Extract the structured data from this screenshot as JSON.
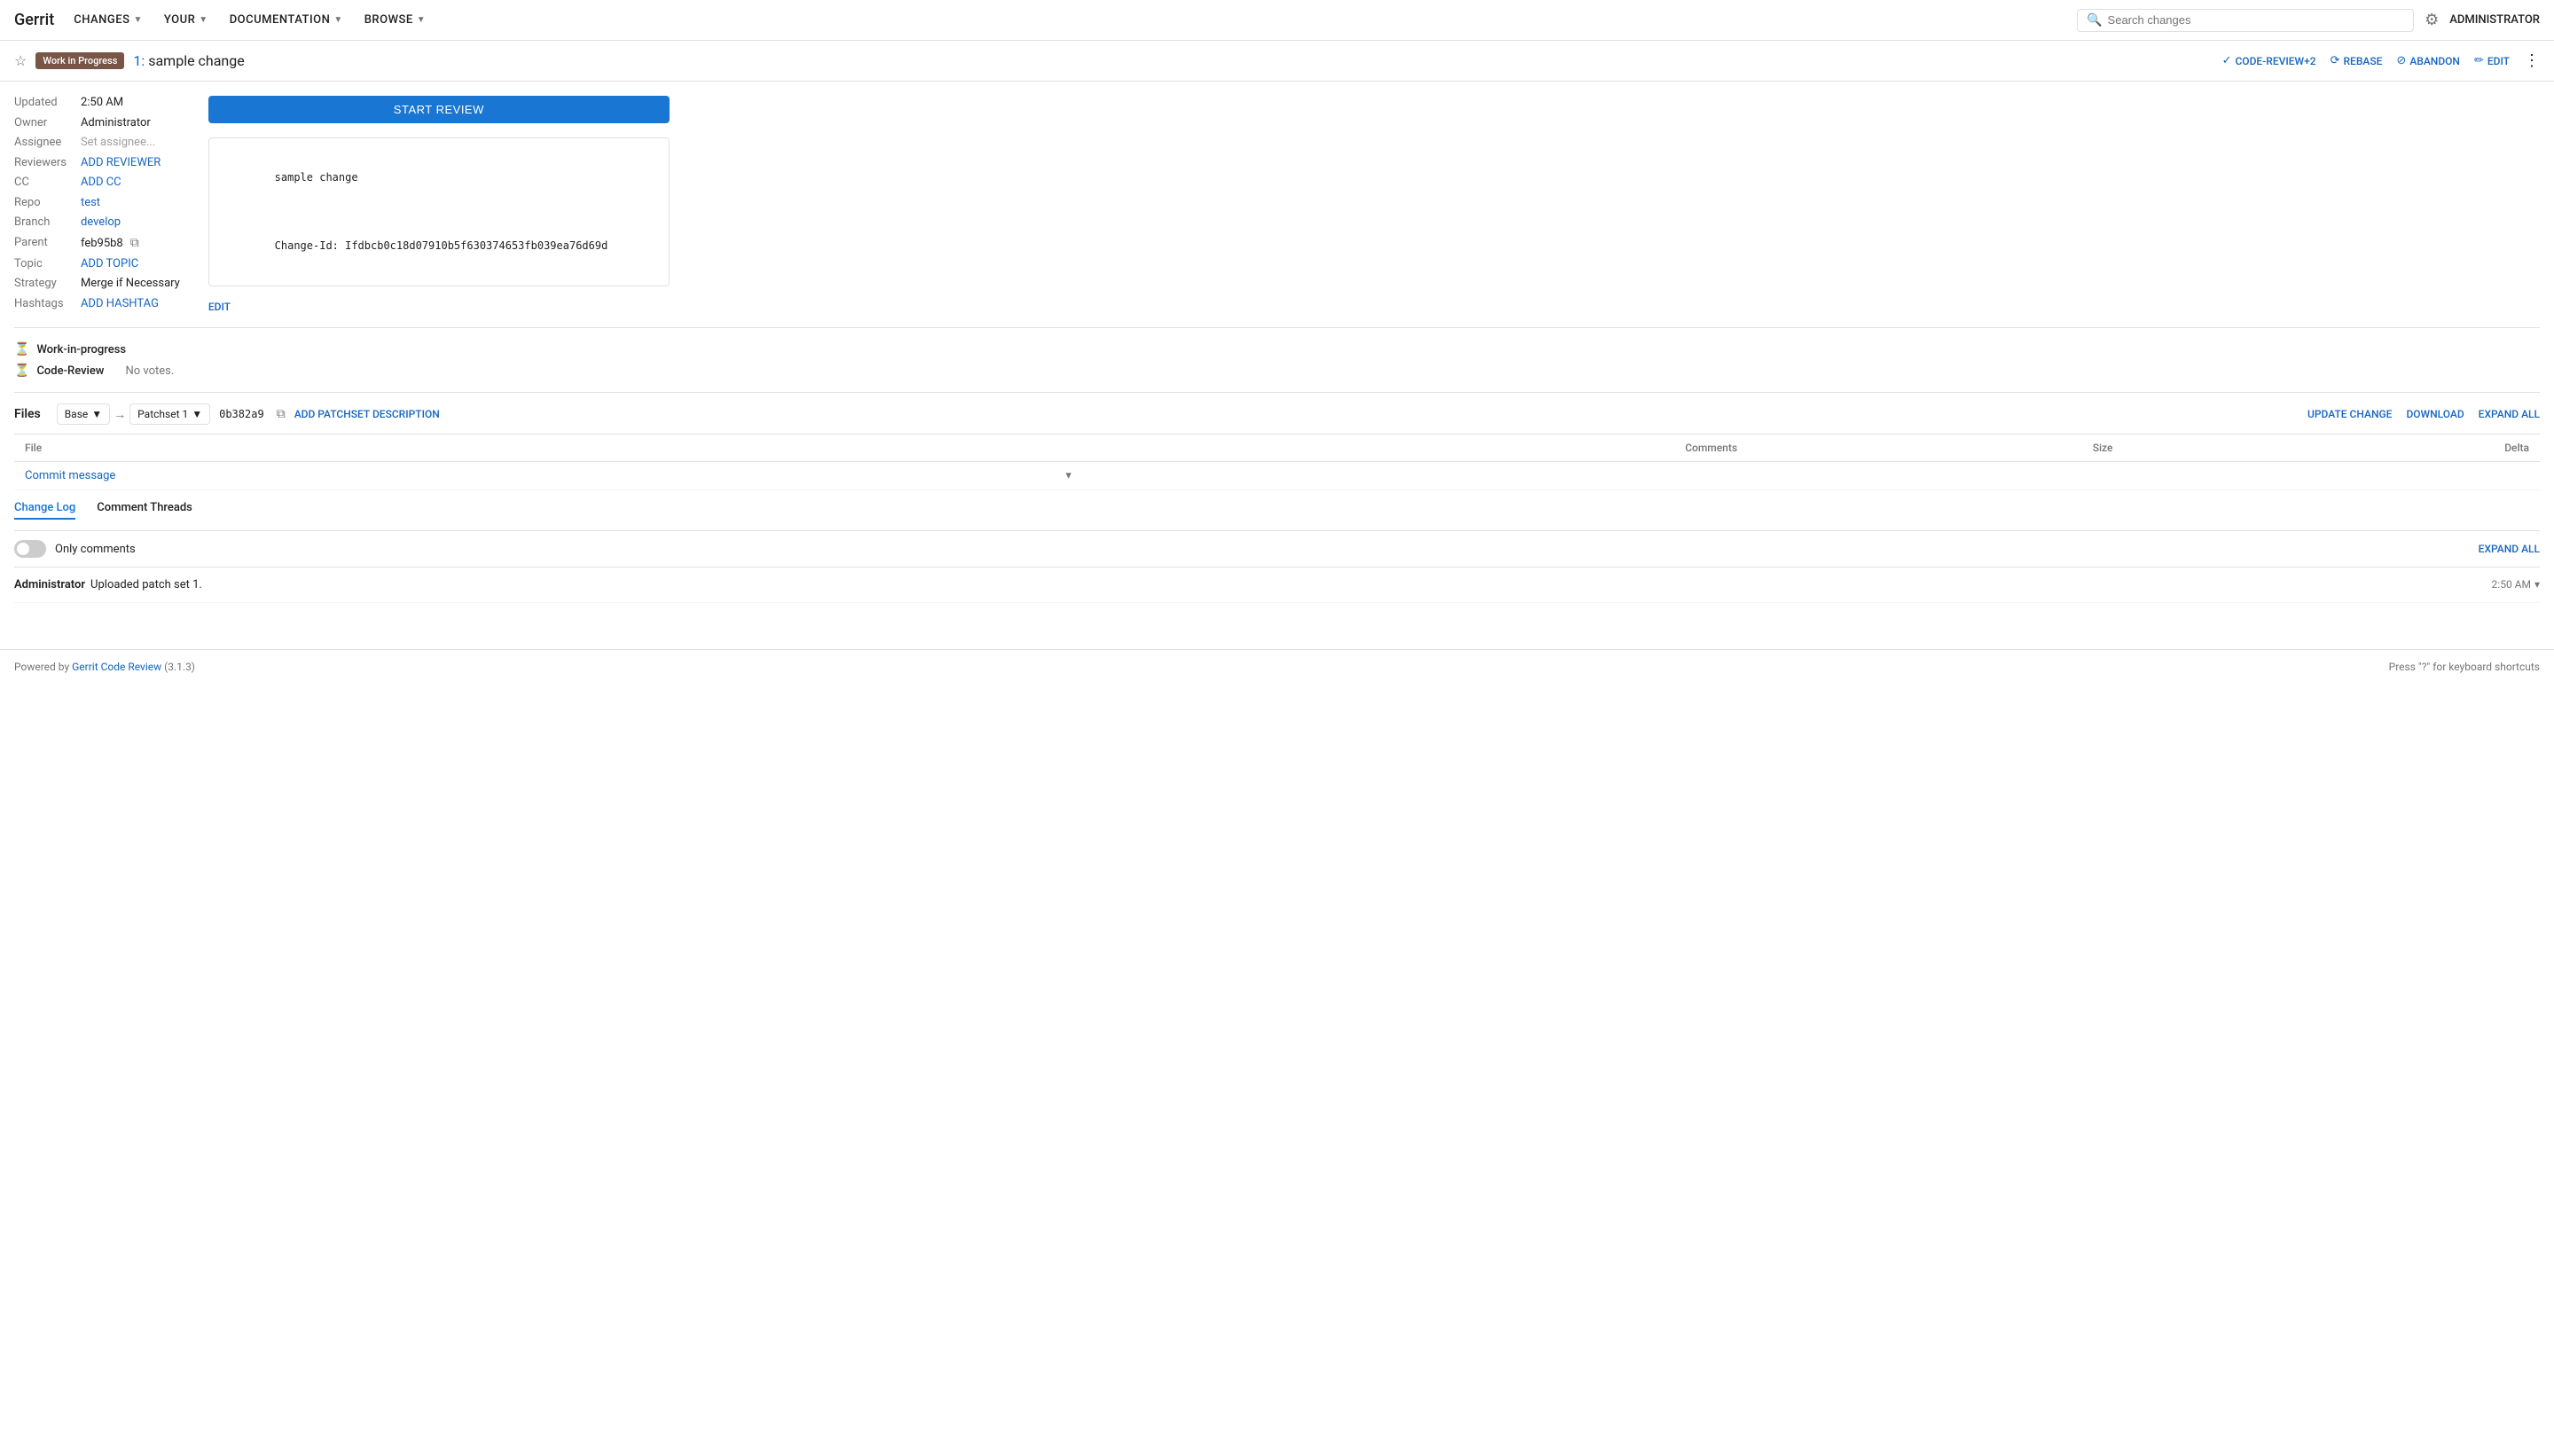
{
  "app": {
    "logo": "Gerrit"
  },
  "navbar": {
    "items": [
      {
        "label": "CHANGES",
        "id": "changes"
      },
      {
        "label": "YOUR",
        "id": "your"
      },
      {
        "label": "DOCUMENTATION",
        "id": "documentation"
      },
      {
        "label": "BROWSE",
        "id": "browse"
      }
    ],
    "search_placeholder": "Search changes",
    "admin_label": "ADMINISTRATOR"
  },
  "change_header": {
    "star_icon": "☆",
    "wip_label": "Work in Progress",
    "change_number": "1",
    "change_title": "sample change",
    "actions": {
      "code_review": "CODE-REVIEW+2",
      "rebase": "REBASE",
      "abandon": "ABANDON",
      "edit": "EDIT",
      "more": "⋮"
    }
  },
  "metadata": {
    "updated_label": "Updated",
    "updated_value": "2:50 AM",
    "owner_label": "Owner",
    "owner_value": "Administrator",
    "assignee_label": "Assignee",
    "assignee_placeholder": "Set assignee...",
    "reviewers_label": "Reviewers",
    "add_reviewer": "ADD REVIEWER",
    "cc_label": "CC",
    "add_cc": "ADD CC",
    "repo_label": "Repo",
    "repo_value": "test",
    "branch_label": "Branch",
    "branch_value": "develop",
    "parent_label": "Parent",
    "parent_value": "feb95b8",
    "topic_label": "Topic",
    "add_topic": "ADD TOPIC",
    "strategy_label": "Strategy",
    "strategy_value": "Merge if Necessary",
    "hashtags_label": "Hashtags",
    "add_hashtag": "ADD HASHTAG"
  },
  "commit_msg": {
    "start_review_label": "START REVIEW",
    "message_line1": "sample change",
    "message_line2": "",
    "message_line3": "Change-Id: Ifdbcb0c18d07910b5f630374653fb039ea76d69d",
    "edit_label": "EDIT"
  },
  "labels": [
    {
      "name": "Work-in-progress",
      "icon": "⏳"
    },
    {
      "name": "Code-Review",
      "icon": "⏳",
      "votes": "No votes."
    }
  ],
  "files": {
    "title": "Files",
    "base_label": "Base",
    "patchset_label": "Patchset 1",
    "commit_hash": "0b382a9",
    "add_patchset_desc": "ADD PATCHSET DESCRIPTION",
    "update_change": "UPDATE CHANGE",
    "download": "DOWNLOAD",
    "expand_all": "EXPAND ALL",
    "columns": {
      "file": "File",
      "comments": "Comments",
      "size": "Size",
      "delta": "Delta"
    },
    "rows": [
      {
        "name": "Commit message",
        "comments": "",
        "size": "",
        "delta": ""
      }
    ]
  },
  "changelog": {
    "tabs": [
      {
        "label": "Change Log",
        "active": true
      },
      {
        "label": "Comment Threads",
        "active": false
      }
    ],
    "only_comments_label": "Only comments",
    "expand_all_label": "EXPAND ALL",
    "entries": [
      {
        "author": "Administrator",
        "message": "Uploaded patch set 1.",
        "time": "2:50 AM"
      }
    ]
  },
  "footer": {
    "powered_by_prefix": "Powered by ",
    "link_text": "Gerrit Code Review",
    "version": "(3.1.3)",
    "keyboard_shortcuts": "Press \"?\" for keyboard shortcuts"
  }
}
